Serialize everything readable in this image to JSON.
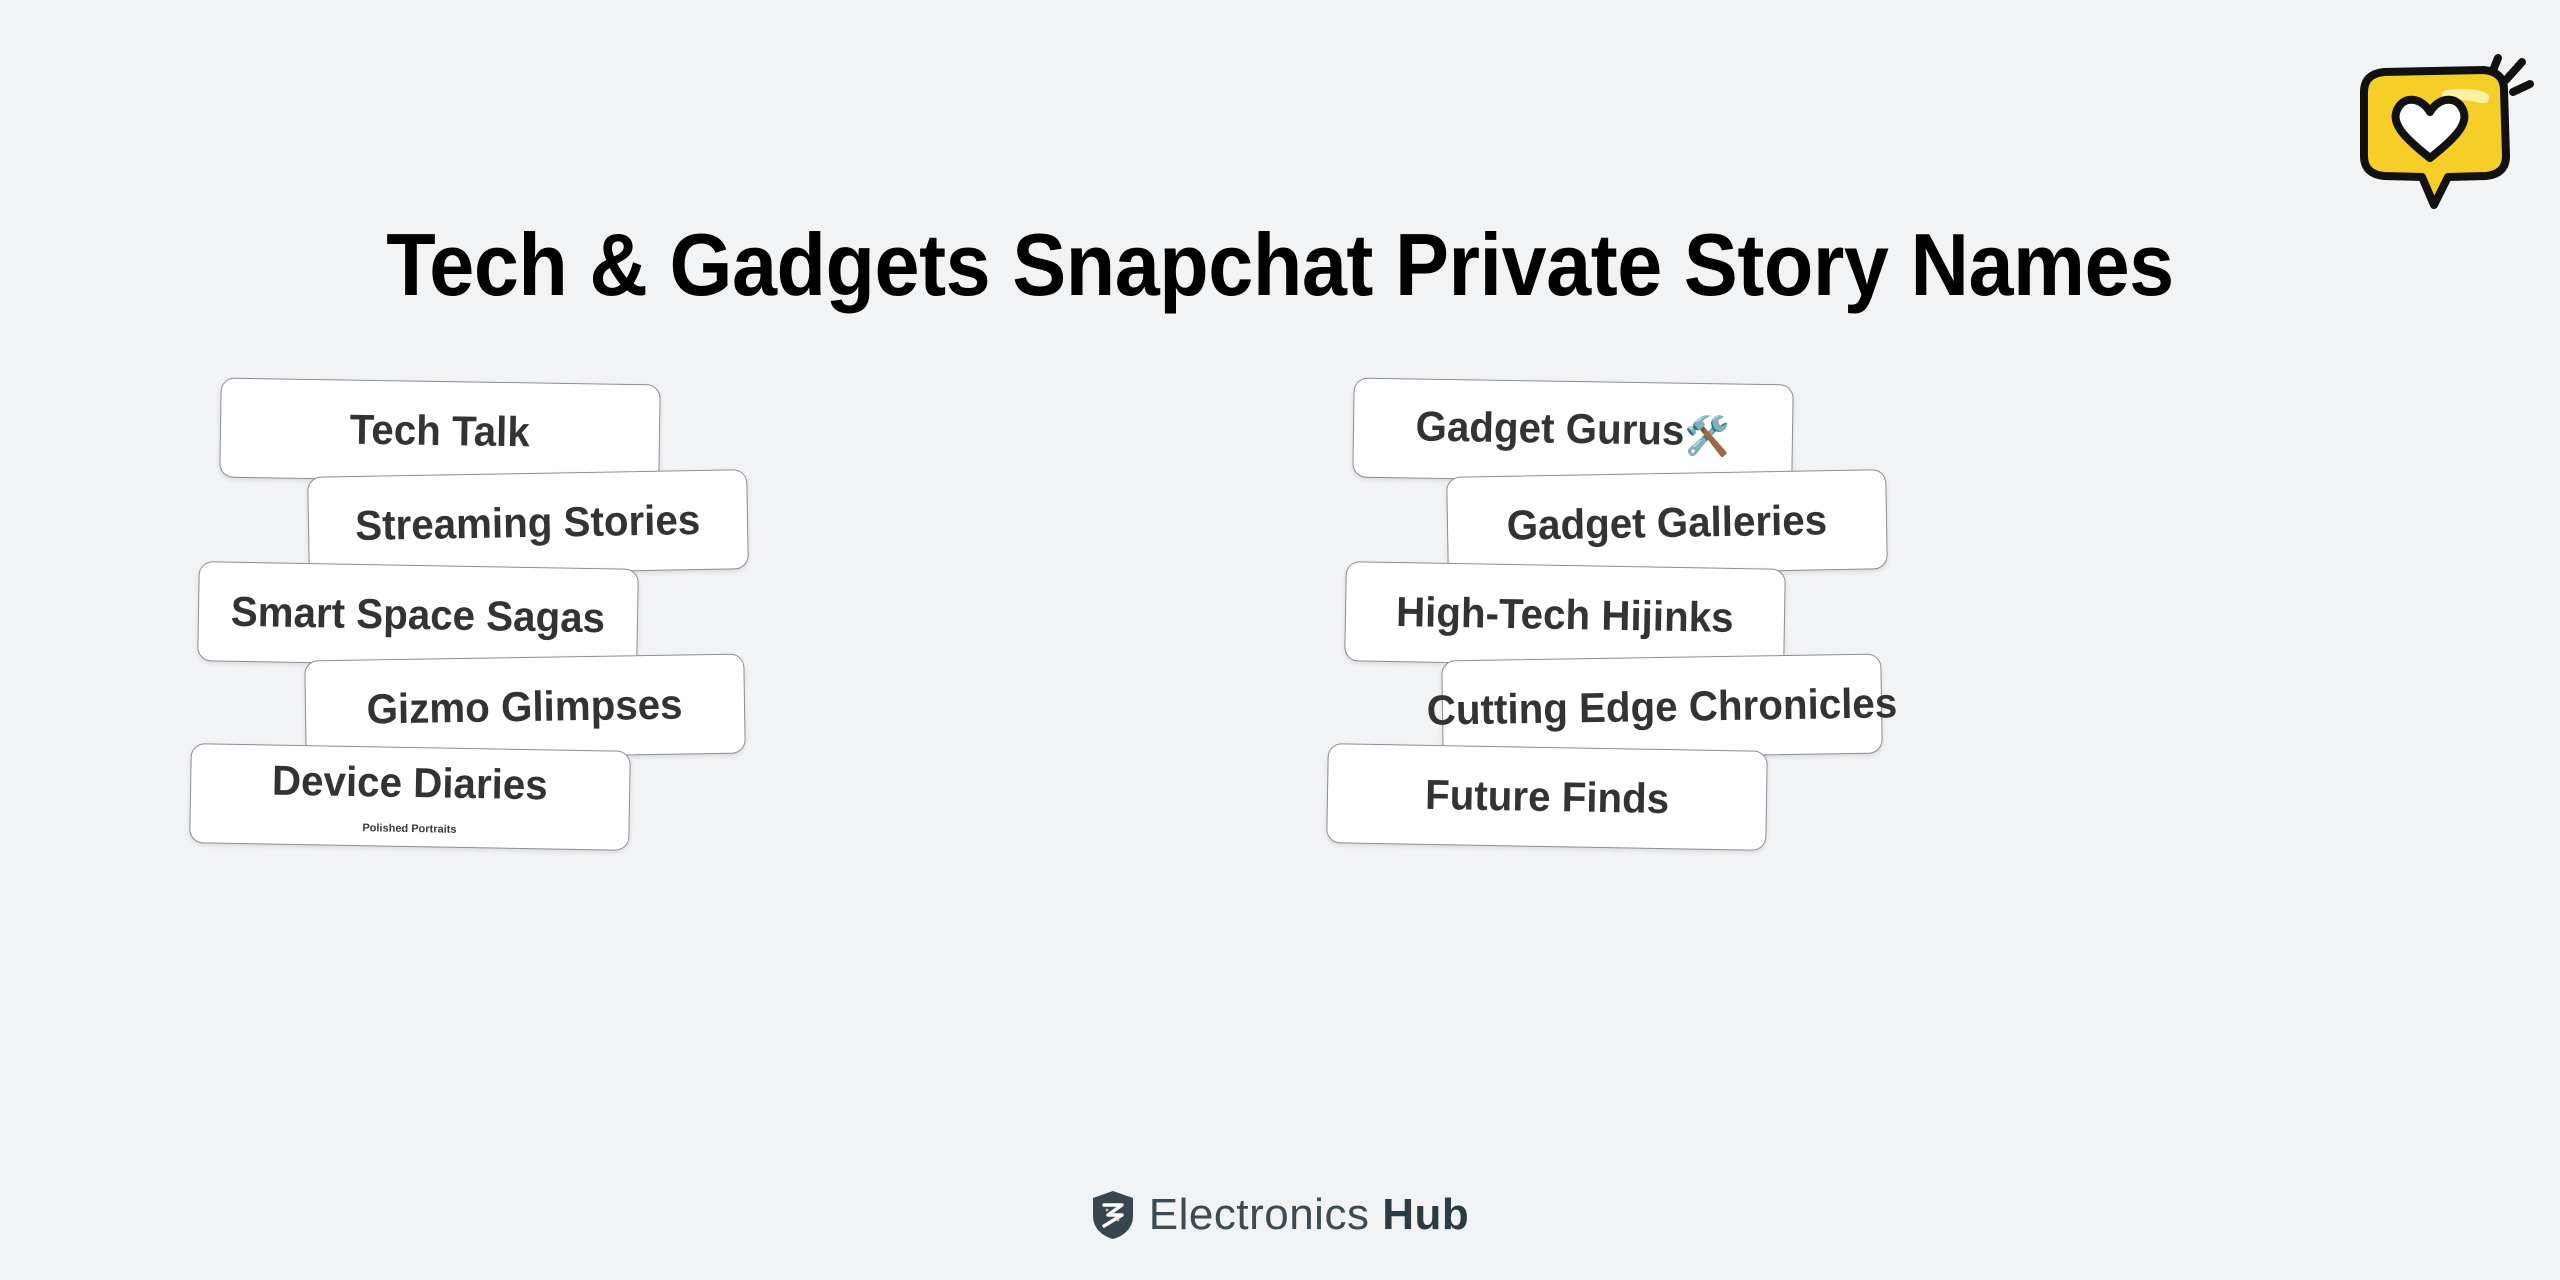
{
  "header": {
    "title": "Tech & Gadgets Snapchat Private Story Names",
    "badge_icon": "heart-speech-bubble-icon",
    "badge_color": "#f5ce28"
  },
  "theme": {
    "background": "#f2f3f5",
    "card_background": "#ffffff",
    "card_border": "#8b8f96",
    "text": "#333333",
    "title_text": "#000000",
    "brand_text": "#3c4a52"
  },
  "columns": [
    {
      "name": "left-column",
      "cards": [
        {
          "label": "Tech Talk"
        },
        {
          "label": "Streaming Stories"
        },
        {
          "label": "Smart Space Sagas"
        },
        {
          "label": "Gizmo Glimpses"
        },
        {
          "label": "Device Diaries",
          "sublabel": "Polished Portraits"
        }
      ]
    },
    {
      "name": "right-column",
      "cards": [
        {
          "label": "Gadget Gurus",
          "emoji": "🛠️",
          "emoji_name": "hammer-and-wrench-icon"
        },
        {
          "label": "Gadget Galleries"
        },
        {
          "label": "High-Tech Hijinks"
        },
        {
          "label": "Cutting Edge Chronicles"
        },
        {
          "label": "Future Finds"
        }
      ]
    }
  ],
  "footer": {
    "brand_first": "Electronics",
    "brand_second": "Hub",
    "logo_icon": "shield-logo-icon"
  }
}
